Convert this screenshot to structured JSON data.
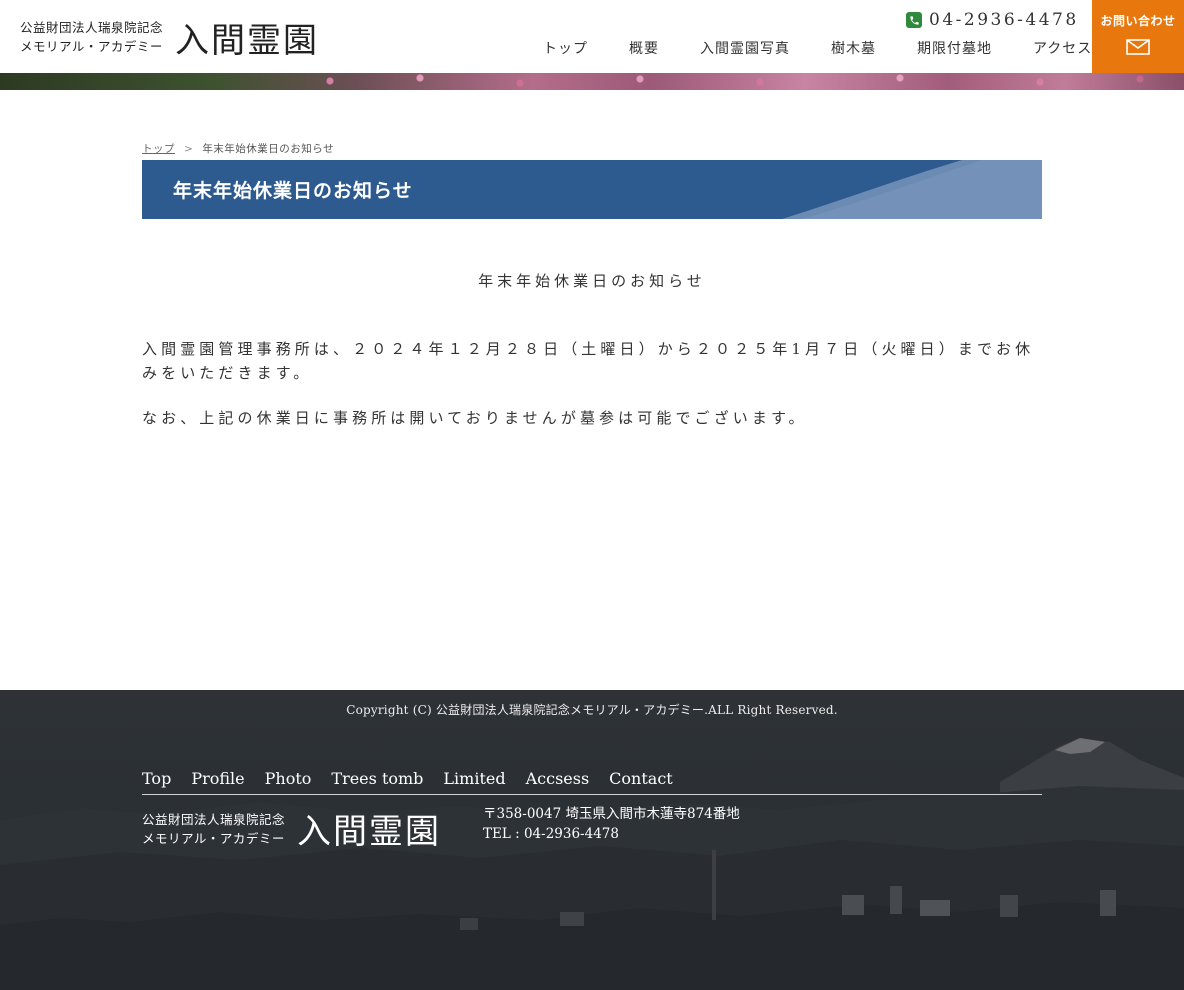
{
  "header": {
    "logo_sub_line1": "公益財団法人瑞泉院記念",
    "logo_sub_line2": "メモリアル・アカデミー",
    "logo_main": "入間霊園",
    "tel": "04-2936-4478",
    "nav": [
      {
        "label": "トップ"
      },
      {
        "label": "概要"
      },
      {
        "label": "入間霊園写真"
      },
      {
        "label": "樹木墓"
      },
      {
        "label": "期限付墓地"
      },
      {
        "label": "アクセス"
      }
    ],
    "contact_label": "お問い合わせ",
    "contact_icon": "mail-icon",
    "tel_icon": "phone-icon",
    "accent_color": "#e8780e"
  },
  "breadcrumb": {
    "home": "トップ",
    "separator": ">",
    "current": "年末年始休業日のお知らせ"
  },
  "page": {
    "title": "年末年始休業日のお知らせ",
    "title_bar_color": "#2d5a8f"
  },
  "article": {
    "heading": "年末年始休業日のお知らせ",
    "paragraph1": "入間霊園管理事務所は、２０２４年１２月２８日（土曜日）から２０２５年1月７日（火曜日）までお休みをいただきます。",
    "paragraph2": "なお、上記の休業日に事務所は開いておりませんが墓参は可能でございます。"
  },
  "footer": {
    "copyright": "Copyright (C) 公益財団法人瑞泉院記念メモリアル・アカデミー.ALL Right Reserved.",
    "nav": [
      {
        "label": "Top"
      },
      {
        "label": "Profile"
      },
      {
        "label": "Photo"
      },
      {
        "label": "Trees tomb"
      },
      {
        "label": "Limited"
      },
      {
        "label": "Accsess"
      },
      {
        "label": "Contact"
      }
    ],
    "logo_sub_line1": "公益財団法人瑞泉院記念",
    "logo_sub_line2": "メモリアル・アカデミー",
    "logo_main": "入間霊園",
    "address": "〒358-0047 埼玉県入間市木蓮寺874番地",
    "tel": "TEL : 04-2936-4478"
  }
}
